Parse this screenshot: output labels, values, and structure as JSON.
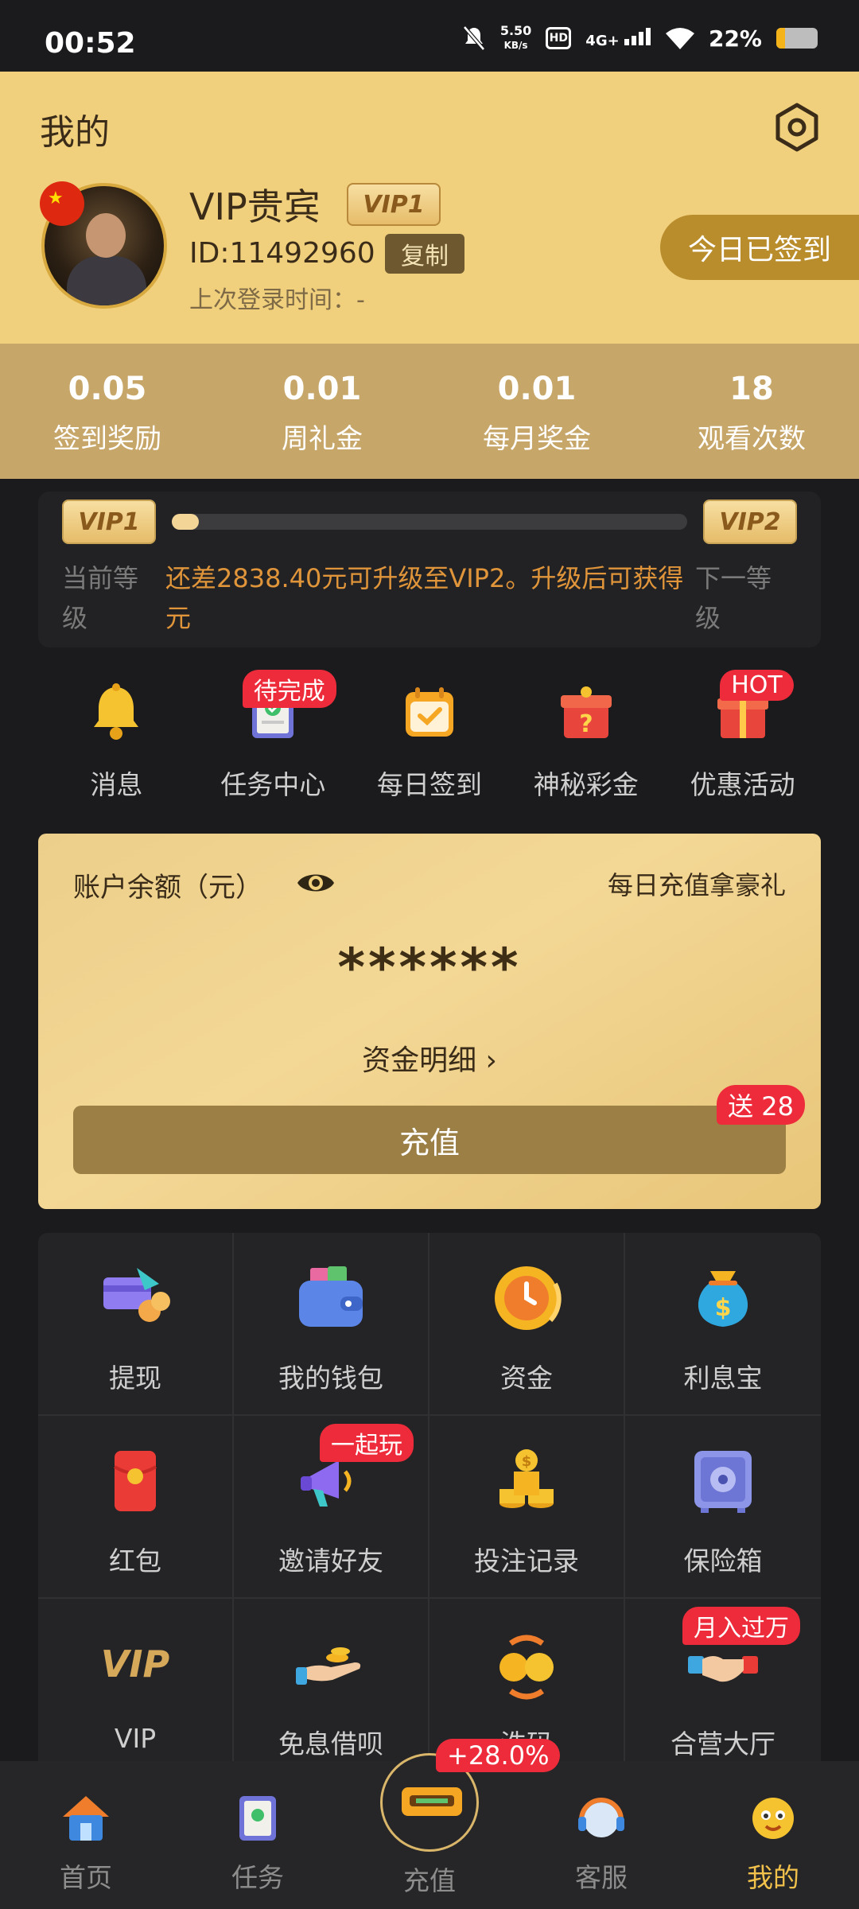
{
  "status_bar": {
    "time": "00:52",
    "speed_value": "5.50",
    "speed_unit": "KB/s",
    "hd": "HD",
    "network": "4G+",
    "battery_text": "22%",
    "battery_level": 0.22
  },
  "header": {
    "title": "我的",
    "vip_name": "VIP贵宾",
    "vip_badge": "VIP1",
    "user_id": "ID:11492960",
    "copy_label": "复制",
    "last_login": "上次登录时间：-",
    "sign_label": "今日已签到"
  },
  "stats": [
    {
      "value": "0.05",
      "label": "签到奖励"
    },
    {
      "value": "0.01",
      "label": "周礼金"
    },
    {
      "value": "0.01",
      "label": "每月奖金"
    },
    {
      "value": "18",
      "label": "观看次数"
    }
  ],
  "vip_progress": {
    "current_level": "VIP1",
    "next_level": "VIP2",
    "progress": 0.05,
    "current_label": "当前等级",
    "message": "还差2838.40元可升级至VIP2。升级后可获得元",
    "next_label": "下一等级"
  },
  "quick_actions": [
    {
      "label": "消息",
      "icon": "bell-icon"
    },
    {
      "label": "任务中心",
      "icon": "task-icon",
      "tag": "待完成"
    },
    {
      "label": "每日签到",
      "icon": "calendar-check-icon"
    },
    {
      "label": "神秘彩金",
      "icon": "mystery-box-icon"
    },
    {
      "label": "优惠活动",
      "icon": "gift-icon",
      "tag": "HOT"
    }
  ],
  "balance": {
    "label": "账户余额（元）",
    "promo": "每日充值拿豪礼",
    "amount": "******",
    "detail_label": "资金明细 ›",
    "recharge_label": "充值",
    "bonus_tag": "送 28"
  },
  "grid": [
    {
      "label": "提现",
      "icon": "withdraw-icon"
    },
    {
      "label": "我的钱包",
      "icon": "wallet-icon"
    },
    {
      "label": "资金",
      "icon": "funds-icon"
    },
    {
      "label": "利息宝",
      "icon": "money-bag-icon"
    },
    {
      "label": "红包",
      "icon": "red-envelope-icon"
    },
    {
      "label": "邀请好友",
      "icon": "megaphone-icon",
      "tag": "一起玩"
    },
    {
      "label": "投注记录",
      "icon": "coins-icon"
    },
    {
      "label": "保险箱",
      "icon": "safe-icon"
    },
    {
      "label": "VIP",
      "icon": "vip-icon"
    },
    {
      "label": "免息借呗",
      "icon": "loan-hand-icon"
    },
    {
      "label": "洗码",
      "icon": "exchange-coins-icon"
    },
    {
      "label": "合营大厅",
      "icon": "handshake-icon",
      "tag": "月入过万"
    }
  ],
  "bottom_nav": [
    {
      "label": "首页",
      "icon": "home-icon"
    },
    {
      "label": "任务",
      "icon": "task-board-icon"
    },
    {
      "label": "充值",
      "icon": "recharge-icon",
      "tag": "+28.0%"
    },
    {
      "label": "客服",
      "icon": "support-icon"
    },
    {
      "label": "我的",
      "icon": "profile-icon",
      "active": true
    }
  ],
  "colors": {
    "gold": "#f0cf7d",
    "stats_bg": "#c7a669",
    "accent_red": "#ee2b3a",
    "dark_bg": "#1b1b1d",
    "active_nav": "#f2c14b"
  }
}
